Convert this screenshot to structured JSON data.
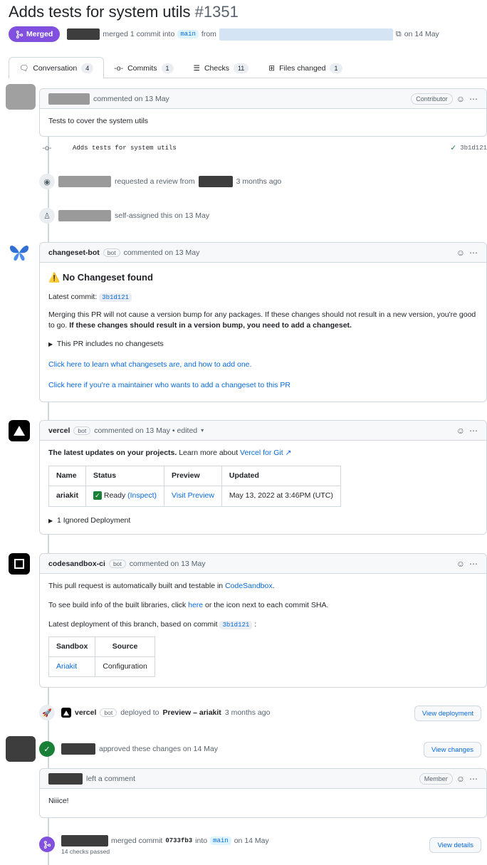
{
  "pr": {
    "title": "Adds tests for system utils",
    "number": "#1351",
    "state": "Merged",
    "meta_text": "merged 1 commit into",
    "base_branch": "main",
    "from_text": "from",
    "date_text": "on 14 May"
  },
  "tabs": [
    {
      "label": "Conversation",
      "count": "4"
    },
    {
      "label": "Commits",
      "count": "1"
    },
    {
      "label": "Checks",
      "count": "11"
    },
    {
      "label": "Files changed",
      "count": "1"
    }
  ],
  "first_comment": {
    "action": "commented on 13 May",
    "role": "Contributor",
    "body": "Tests to cover the system utils"
  },
  "commit": {
    "message": "Adds tests for system utils",
    "sha": "3b1d121"
  },
  "review_request": {
    "text": "requested a review from",
    "time": "3 months ago"
  },
  "self_assign": {
    "text": "self-assigned this on 13 May"
  },
  "changeset": {
    "author": "changeset-bot",
    "bot_label": "bot",
    "action": "commented on 13 May",
    "heading": "No Changeset found",
    "latest_commit_label": "Latest commit:",
    "latest_commit_sha": "3b1d121",
    "para_normal": "Merging this PR will not cause a version bump for any packages. If these changes should not result in a new version, you're good to go.",
    "para_bold": "If these changes should result in a version bump, you need to add a changeset.",
    "details": "This PR includes no changesets",
    "link1": "Click here to learn what changesets are, and how to add one.",
    "link2": "Click here if you're a maintainer who wants to add a changeset to this PR"
  },
  "vercel": {
    "author": "vercel",
    "bot_label": "bot",
    "action": "commented on 13 May • edited",
    "intro_bold": "The latest updates on your projects.",
    "intro_normal": "Learn more about",
    "intro_link": "Vercel for Git ↗",
    "table": {
      "headers": [
        "Name",
        "Status",
        "Preview",
        "Updated"
      ],
      "row": {
        "name": "ariakit",
        "status": "Ready",
        "inspect": "(Inspect)",
        "preview": "Visit Preview",
        "updated": "May 13, 2022 at 3:46PM (UTC)"
      }
    },
    "details": "1 Ignored Deployment"
  },
  "codesandbox": {
    "author": "codesandbox-ci",
    "bot_label": "bot",
    "action": "commented on 13 May",
    "line1_a": "This pull request is automatically built and testable in",
    "line1_link": "CodeSandbox",
    "line2_a": "To see build info of the built libraries, click",
    "line2_link": "here",
    "line2_b": "or the icon next to each commit SHA.",
    "line3_a": "Latest deployment of this branch, based on commit",
    "line3_sha": "3b1d121",
    "table": {
      "headers": [
        "Sandbox",
        "Source"
      ],
      "row": {
        "sandbox": "Ariakit",
        "source": "Configuration"
      }
    }
  },
  "deploy_event": {
    "author": "vercel",
    "bot_label": "bot",
    "text_a": "deployed to",
    "env": "Preview – ariakit",
    "time": "3 months ago",
    "button": "View deployment"
  },
  "approve_event": {
    "text": "approved these changes on 14 May",
    "button": "View changes"
  },
  "review_comment": {
    "action": "left a comment",
    "role": "Member",
    "body": "Niiice!"
  },
  "merge_event": {
    "text_a": "merged commit",
    "sha": "0733fb3",
    "text_b": "into",
    "branch": "main",
    "date": "on 14 May",
    "checks": "14 checks passed",
    "button": "View details"
  },
  "colors": {
    "merged": "#8250df",
    "success": "#1a7f37",
    "link": "#0969da"
  }
}
